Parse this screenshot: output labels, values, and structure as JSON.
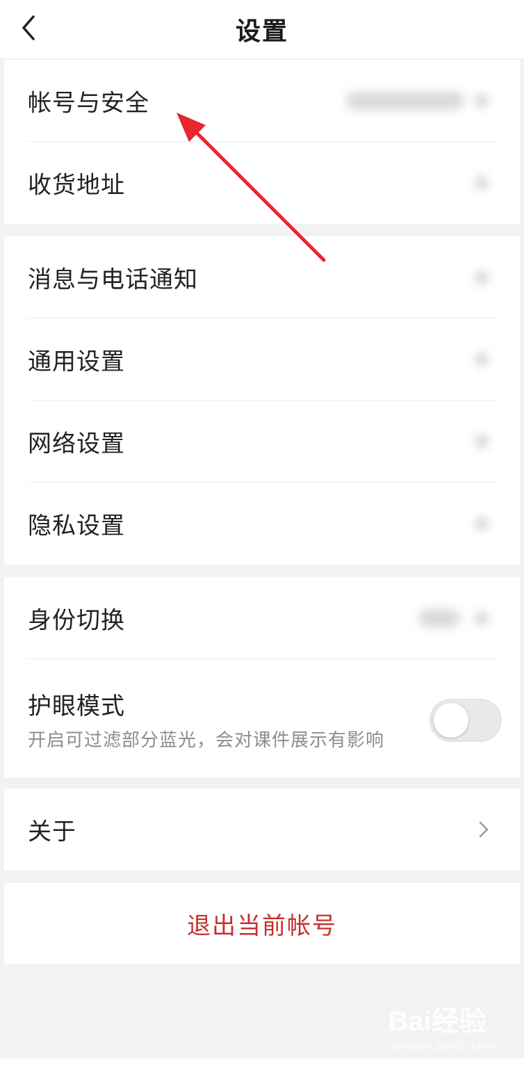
{
  "header": {
    "title": "设置"
  },
  "group1": {
    "items": [
      {
        "label": "帐号与安全"
      },
      {
        "label": "收货地址"
      }
    ]
  },
  "group2": {
    "items": [
      {
        "label": "消息与电话通知"
      },
      {
        "label": "通用设置"
      },
      {
        "label": "网络设置"
      },
      {
        "label": "隐私设置"
      }
    ]
  },
  "group3": {
    "identity": {
      "label": "身份切换"
    },
    "eye_mode": {
      "label": "护眼模式",
      "description": "开启可过滤部分蓝光，会对课件展示有影响",
      "enabled": false
    }
  },
  "group4": {
    "about": {
      "label": "关于"
    }
  },
  "logout": {
    "label": "退出当前帐号"
  },
  "watermark": {
    "brand": "Bai经验",
    "url": "jingyan.baidu.com"
  },
  "colors": {
    "logout_text": "#c7302d",
    "annotation_arrow": "#e8262b",
    "page_background": "#f2f2f2"
  }
}
